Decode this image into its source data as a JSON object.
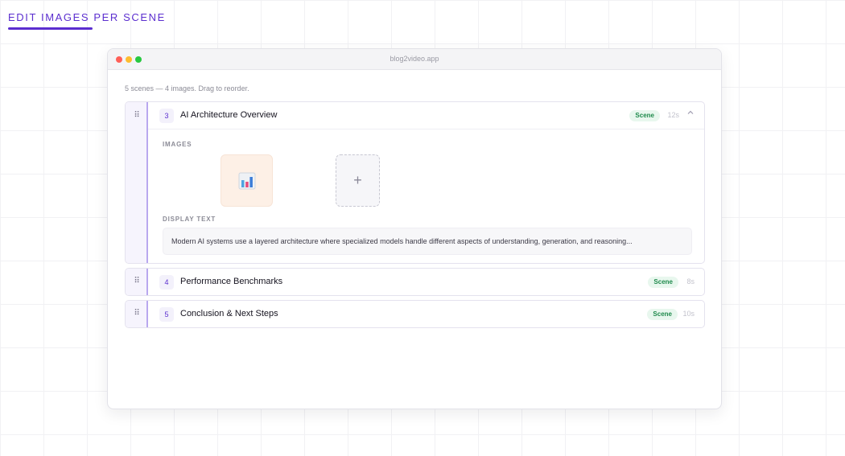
{
  "page": {
    "heading": "EDIT IMAGES PER SCENE"
  },
  "window": {
    "url": "blog2video.app",
    "summary": "5 scenes — 4 images. Drag to reorder."
  },
  "scenes": [
    {
      "number": "3",
      "title": "AI Architecture Overview",
      "badge": "Scene",
      "duration": "12s",
      "expanded": true,
      "images_label": "IMAGES",
      "images": [
        {
          "icon": "bar-chart-icon"
        }
      ],
      "add_image_label": "+",
      "display_text_label": "DISPLAY TEXT",
      "display_text": "Modern AI systems use a layered architecture where specialized models handle different aspects of understanding, generation, and reasoning..."
    },
    {
      "number": "4",
      "title": "Performance Benchmarks",
      "badge": "Scene",
      "duration": "8s",
      "expanded": false
    },
    {
      "number": "5",
      "title": "Conclusion & Next Steps",
      "badge": "Scene",
      "duration": "10s",
      "expanded": false
    }
  ],
  "colors": {
    "accent": "#5b2ecf",
    "badge_bg": "#e8f7ee",
    "badge_text": "#1f8a4c"
  },
  "icons": {
    "drag_handle": "⠿",
    "collapse_chevron": "chevron-up-icon"
  }
}
